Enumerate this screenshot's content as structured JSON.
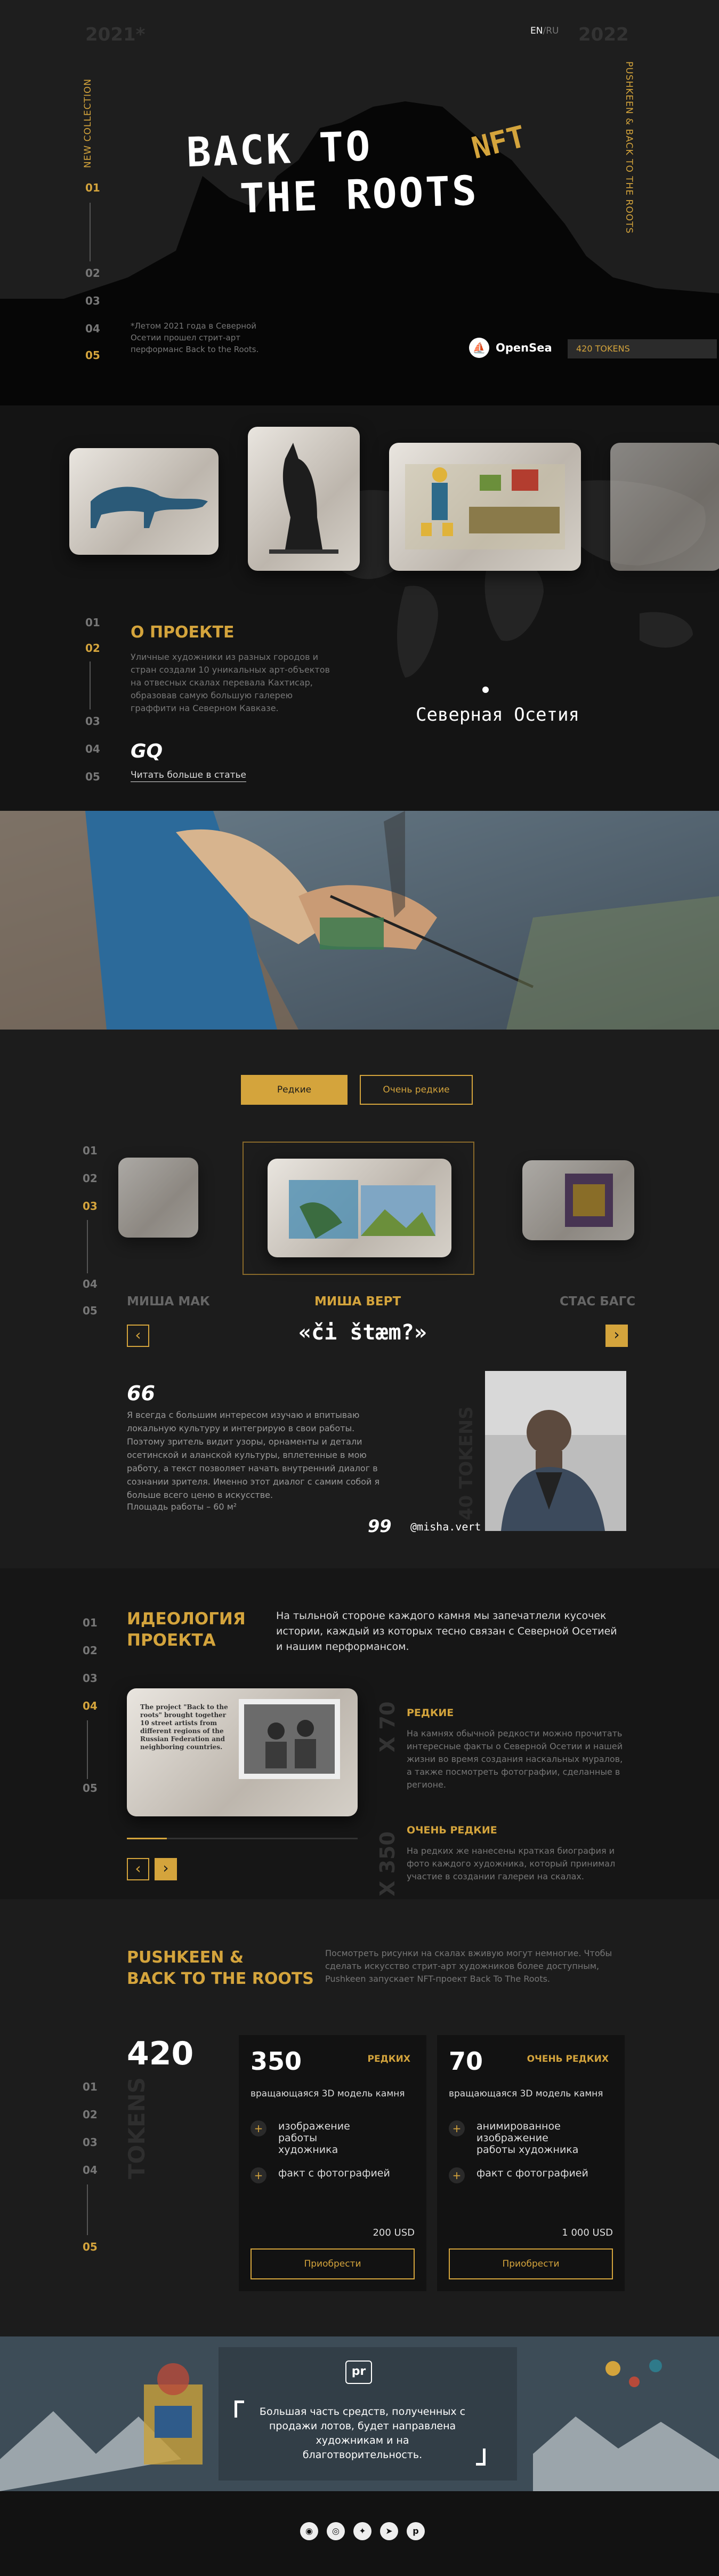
{
  "header": {
    "year_left": "2021*",
    "year_right": "2022",
    "lang_en": "EN",
    "lang_sep": "/",
    "lang_ru": "RU",
    "side_left": "NEW COLLECTION",
    "side_right": "PUSHKEEN & BACK TO THE ROOTS"
  },
  "hero": {
    "title_line1": "BACK TO",
    "title_line2": "THE ROOTS",
    "nft": "NFT",
    "pages": [
      "01",
      "02",
      "03",
      "04",
      "05"
    ],
    "active_page": "01",
    "footnote": "*Летом 2021 года в Северной Осетии прошел стрит-арт перформанс Back to the Roots.",
    "opensea": "OpenSea",
    "tokens": "420 TOKENS"
  },
  "about": {
    "pages": [
      "01",
      "02",
      "03",
      "04",
      "05"
    ],
    "active_page": "02",
    "heading": "О ПРОЕКТЕ",
    "text": "Уличные художники из разных городов и стран создали 10 уникальных арт-объектов на отвесных скалах перевала Кахтисар, образовав самую большую галерею граффити на Северном Кавказе.",
    "gq": "GQ",
    "read_more": "Читать больше в статье",
    "map_label": "Северная Осетия"
  },
  "gallery": {
    "tab_rare": "Редкие",
    "tab_very_rare": "Очень редкие",
    "pages": [
      "01",
      "02",
      "03",
      "04",
      "05"
    ],
    "active_page": "03",
    "artist_left": "МИША МАК",
    "artist_center": "МИША ВЕРТ",
    "artist_right": "СТАС БАГС",
    "tag": "«či štæm?»",
    "prev": "‹",
    "next": "›",
    "quote_open": "66",
    "quote_close": "99",
    "quote": "Я всегда с большим интересом изучаю и впитываю локальную культуру и интегрирую в свои работы. Поэтому зритель видит узоры, орнаменты и детали осетинской и аланской культуры, вплетенные в мою работу, а текст позволяет начать внутренний диалог в сознании зрителя. Именно этот диалог с самим собой я больше всего ценю в искусстве.",
    "area": "Площадь работы – 60 м²",
    "signature": "@misha.vert",
    "vertical_tokens": "40 TOKENS"
  },
  "ideology": {
    "pages": [
      "01",
      "02",
      "03",
      "04",
      "05"
    ],
    "active_page": "04",
    "heading_line1": "ИДЕОЛОГИЯ",
    "heading_line2": "ПРОЕКТА",
    "intro": "На тыльной стороне каждого камня мы запечатлели кусочек истории, каждый из которых тесно связан с Северной Осетией и нашим перформансом.",
    "stone_text": "The project \"Back to the roots\" brought together 10 street artists from different regions of the Russian Federation and neighboring countries.",
    "x70": "X 70",
    "x350": "X 350",
    "rare_title": "РЕДКИЕ",
    "rare_text": "На камнях обычной редкости можно прочитать интересные факты о Северной Осетии и нашей жизни во время создания наскальных муралов, а также посмотреть фотографии, сделанные в регионе.",
    "vrare_title": "ОЧЕНЬ РЕДКИЕ",
    "vrare_text": "На редких же нанесены краткая биография и фото каждого художника, который принимал участие в создании галереи на скалах.",
    "prev": "‹",
    "next": "›"
  },
  "pricing": {
    "heading_line1": "PUSHKEEN &",
    "heading_line2": "BACK TO THE ROOTS",
    "intro": "Посмотреть рисунки на скалах вживую могут немногие. Чтобы сделать искусство стрит-арт художников более доступным, Pushkeen запускает NFT-проект Back To The Roots.",
    "total": "420",
    "total_label": "TOKENS",
    "pages": [
      "01",
      "02",
      "03",
      "04",
      "05"
    ],
    "active_page": "05",
    "card1": {
      "count": "350",
      "type": "РЕДКИХ",
      "subtitle": "вращающаяся 3D модель камня",
      "features": [
        "изображение работы художника",
        "факт с фотографией"
      ],
      "price": "200 USD",
      "buy": "Приобрести"
    },
    "card2": {
      "count": "70",
      "type": "ОЧЕНЬ РЕДКИХ",
      "subtitle": "вращающаяся 3D модель камня",
      "features": [
        "анимированное изображение работы художника",
        "факт с фотографией"
      ],
      "price": "1 000 USD",
      "buy": "Приобрести"
    }
  },
  "banner": {
    "logo": "pr",
    "text": "Большая часть средств, полученных с продажи лотов, будет направлена художникам и на благотворительность."
  },
  "footer": {
    "icons": [
      "reddit-icon",
      "instagram-icon",
      "twitter-icon",
      "telegram-icon",
      "pushkeen-icon"
    ]
  },
  "colors": {
    "accent": "#d4a43c",
    "background": "#1c1c1c"
  }
}
